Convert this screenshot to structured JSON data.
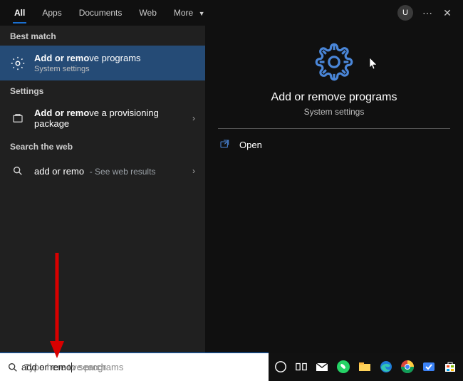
{
  "tabs": {
    "items": [
      {
        "label": "All",
        "active": true
      },
      {
        "label": "Apps"
      },
      {
        "label": "Documents"
      },
      {
        "label": "Web"
      },
      {
        "label": "More"
      }
    ],
    "avatar_initial": "U"
  },
  "left": {
    "best_match_label": "Best match",
    "best_match": {
      "title_bold": "Add or remo",
      "title_rest": "ve programs",
      "sub": "System settings"
    },
    "settings_label": "Settings",
    "settings_item": {
      "title_bold": "Add or remo",
      "title_rest": "ve a provisioning package"
    },
    "web_label": "Search the web",
    "web_item": {
      "query": "add or remo",
      "hint": "- See web results"
    }
  },
  "preview": {
    "title": "Add or remove programs",
    "sub": "System settings",
    "open_label": "Open"
  },
  "search": {
    "typed": "add or remo",
    "completion": "ve programs",
    "placeholder": "Type here to search"
  }
}
